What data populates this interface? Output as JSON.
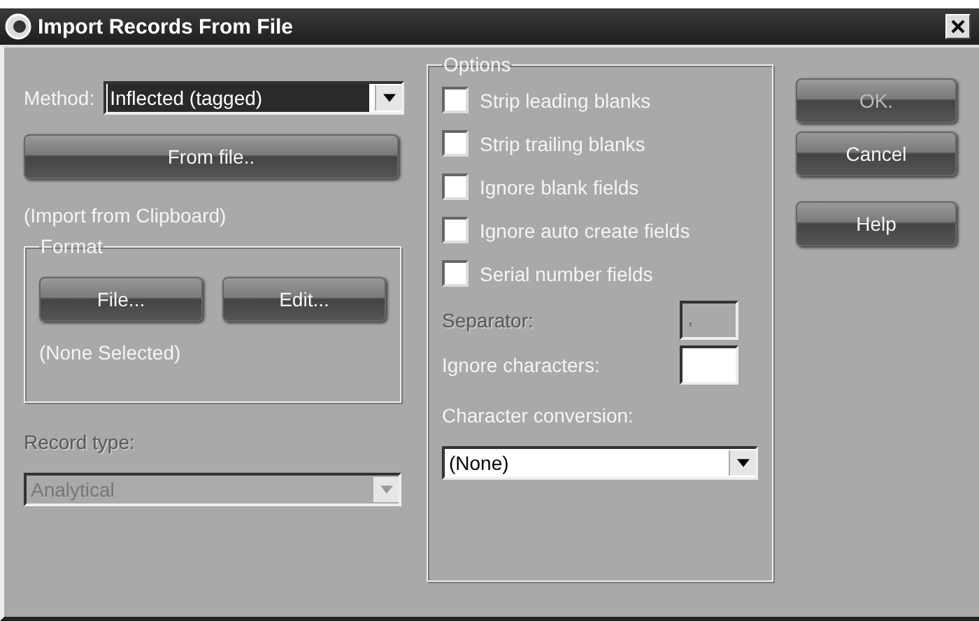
{
  "window": {
    "title": "Import Records From File"
  },
  "method": {
    "label": "Method:",
    "value": "Inflected (tagged)",
    "highlighted": true
  },
  "from_file_button": {
    "label": "From file.."
  },
  "import_source": "(Import from Clipboard)",
  "format": {
    "title": "Format",
    "buttons": [
      {
        "label": "File..."
      },
      {
        "label": "Edit..."
      }
    ],
    "selection": "(None Selected)"
  },
  "record_type": {
    "label": "Record type:",
    "value": "Analytical",
    "disabled": true
  },
  "options": {
    "title": "Options",
    "checkboxes": [
      {
        "label": "Strip leading blanks",
        "checked": false
      },
      {
        "label": "Strip trailing blanks",
        "checked": false
      },
      {
        "label": "Ignore blank fields",
        "checked": false
      },
      {
        "label": "Ignore auto create fields",
        "checked": false
      },
      {
        "label": "Serial number fields",
        "checked": false
      }
    ],
    "separator": {
      "label": "Separator:",
      "value": ",",
      "disabled": true
    },
    "ignore_characters": {
      "label": "Ignore characters:",
      "disabled": false
    },
    "character_conversion": {
      "label": "Character conversion:",
      "value": "(None)"
    }
  },
  "buttons": [
    {
      "label": "OK.",
      "disabled": true
    },
    {
      "label": "Cancel",
      "disabled": false
    },
    {
      "label": "Help",
      "disabled": false
    }
  ]
}
